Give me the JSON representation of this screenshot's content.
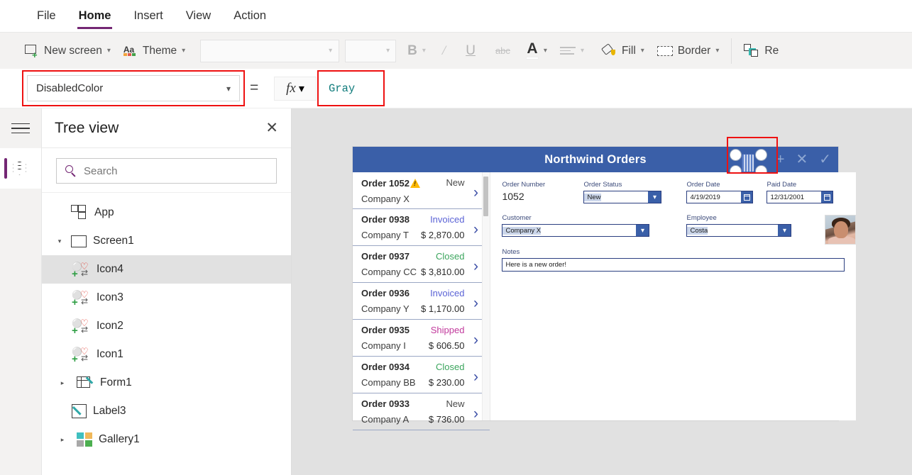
{
  "ribbon": {
    "tabs": [
      {
        "label": "File",
        "active": false
      },
      {
        "label": "Home",
        "active": true
      },
      {
        "label": "Insert",
        "active": false
      },
      {
        "label": "View",
        "active": false
      },
      {
        "label": "Action",
        "active": false
      }
    ]
  },
  "toolbar": {
    "new_screen": "New screen",
    "theme": "Theme",
    "font_value": "",
    "font_size_value": "",
    "bold": "B",
    "italic": "I",
    "underline": "U",
    "strikethrough": "abc",
    "font_color": "A",
    "align": "align",
    "fill": "Fill",
    "border": "Border",
    "reorder": "Re"
  },
  "formula_bar": {
    "property": "DisabledColor",
    "equals": "=",
    "fx": "fx",
    "value": "Gray",
    "value_color": "#0f7b7b"
  },
  "tree_panel": {
    "title": "Tree view",
    "close": "✕",
    "search_placeholder": "Search",
    "items": [
      {
        "label": "App",
        "icon": "app-icon",
        "indent": 0,
        "twisty": "",
        "selected": false
      },
      {
        "label": "Screen1",
        "icon": "screen-icon",
        "indent": 0,
        "twisty": "down",
        "selected": false
      },
      {
        "label": "Icon4",
        "icon": "icon-component-icon",
        "indent": 1,
        "twisty": "",
        "selected": true
      },
      {
        "label": "Icon3",
        "icon": "icon-component-icon",
        "indent": 1,
        "twisty": "",
        "selected": false
      },
      {
        "label": "Icon2",
        "icon": "icon-component-icon",
        "indent": 1,
        "twisty": "",
        "selected": false
      },
      {
        "label": "Icon1",
        "icon": "icon-component-icon",
        "indent": 1,
        "twisty": "",
        "selected": false
      },
      {
        "label": "Form1",
        "icon": "form-icon",
        "indent": 1,
        "twisty": "right",
        "selected": false
      },
      {
        "label": "Label3",
        "icon": "label-icon",
        "indent": 1,
        "twisty": "",
        "selected": false
      },
      {
        "label": "Gallery1",
        "icon": "gallery-icon",
        "indent": 1,
        "twisty": "right",
        "selected": false
      }
    ]
  },
  "rail": {
    "hamburger": "menu-icon",
    "layers": "layers-icon"
  },
  "app_preview": {
    "header_title": "Northwind Orders",
    "header_color": "#3a5fa8",
    "header_icons": [
      "add-icon",
      "cancel-icon",
      "check-icon"
    ],
    "selected_icon_name": "selected-icon-handles",
    "gallery": [
      {
        "order": "Order 1052",
        "company": "Company X",
        "status": "New",
        "status_color": "#4a4a4a",
        "amount": "",
        "warning": true
      },
      {
        "order": "Order 0938",
        "company": "Company T",
        "status": "Invoiced",
        "status_color": "#5b63d6",
        "amount": "$ 2,870.00",
        "warning": false
      },
      {
        "order": "Order 0937",
        "company": "Company CC",
        "status": "Closed",
        "status_color": "#3ba55d",
        "amount": "$ 3,810.00",
        "warning": false
      },
      {
        "order": "Order 0936",
        "company": "Company Y",
        "status": "Invoiced",
        "status_color": "#5b63d6",
        "amount": "$ 1,170.00",
        "warning": false
      },
      {
        "order": "Order 0935",
        "company": "Company I",
        "status": "Shipped",
        "status_color": "#c1399c",
        "amount": "$ 606.50",
        "warning": false
      },
      {
        "order": "Order 0934",
        "company": "Company BB",
        "status": "Closed",
        "status_color": "#3ba55d",
        "amount": "$ 230.00",
        "warning": false
      },
      {
        "order": "Order 0933",
        "company": "Company A",
        "status": "New",
        "status_color": "#4a4a4a",
        "amount": "$ 736.00",
        "warning": false
      }
    ],
    "form": {
      "order_number_label": "Order Number",
      "order_number_value": "1052",
      "order_status_label": "Order Status",
      "order_status_value": "New",
      "order_date_label": "Order Date",
      "order_date_value": "4/19/2019",
      "paid_date_label": "Paid Date",
      "paid_date_value": "12/31/2001",
      "customer_label": "Customer",
      "customer_value": "Company X",
      "employee_label": "Employee",
      "employee_value": "Costa",
      "notes_label": "Notes",
      "notes_value": "Here is a new order!"
    }
  },
  "annotations": {
    "color": "#ee1111",
    "boxes": [
      "property-selector-highlight",
      "formula-value-highlight",
      "selected-icon-highlight"
    ]
  }
}
